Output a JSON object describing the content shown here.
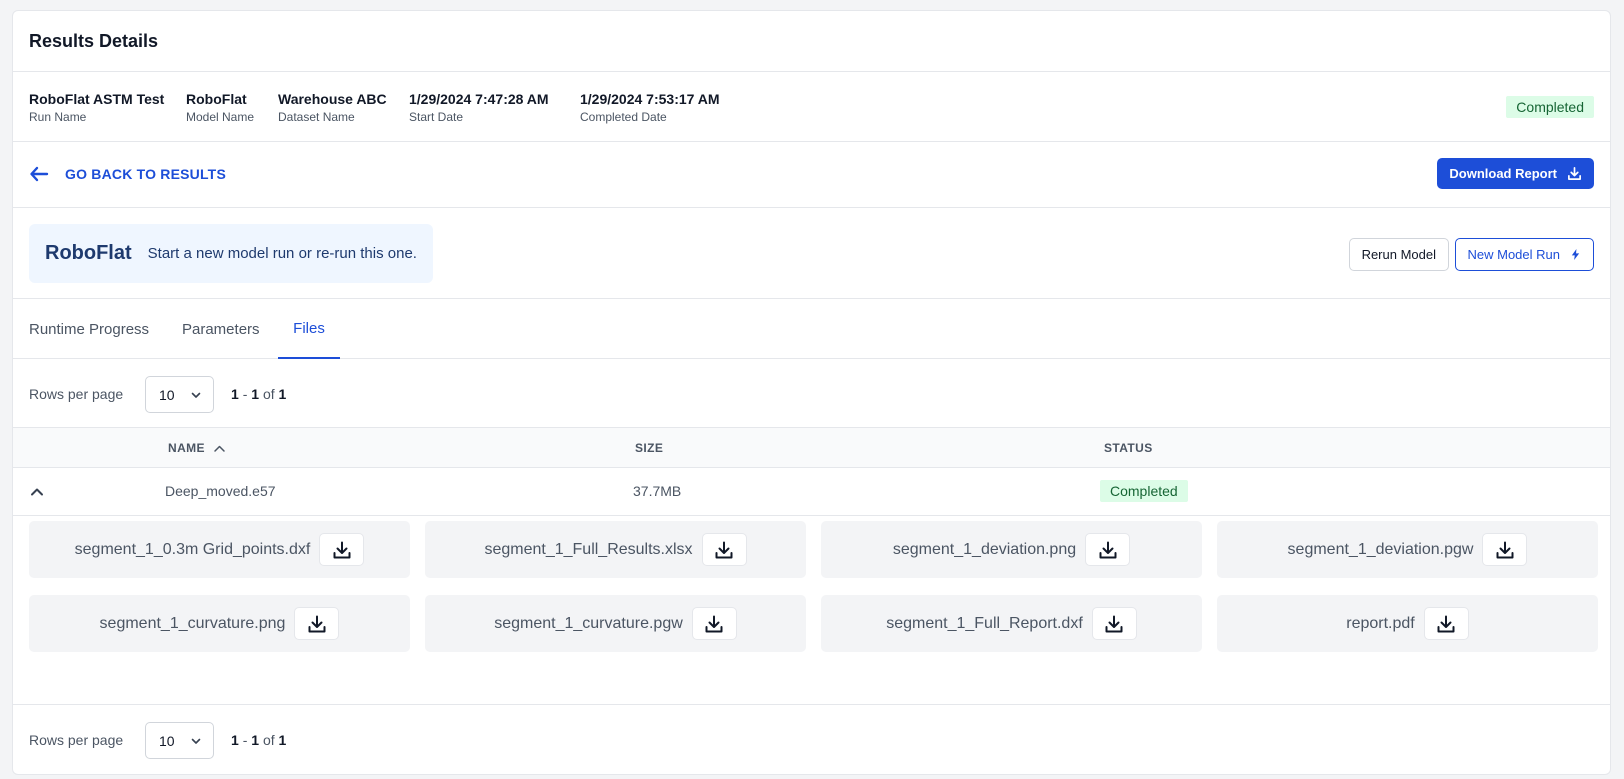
{
  "header": {
    "title": "Results Details"
  },
  "run": {
    "run_name": {
      "value": "RoboFlat ASTM Test",
      "label": "Run Name"
    },
    "model_name": {
      "value": "RoboFlat",
      "label": "Model Name"
    },
    "dataset_name": {
      "value": "Warehouse ABC",
      "label": "Dataset Name"
    },
    "start_date": {
      "value": "1/29/2024 7:47:28 AM",
      "label": "Start Date"
    },
    "completed_date": {
      "value": "1/29/2024 7:53:17 AM",
      "label": "Completed Date"
    },
    "status": "Completed"
  },
  "nav": {
    "back_label": "GO BACK TO RESULTS",
    "download_report_label": "Download Report"
  },
  "model_banner": {
    "model_name": "RoboFlat",
    "subtitle": "Start a new model run or re-run this one.",
    "rerun_label": "Rerun Model",
    "new_run_label": "New Model Run"
  },
  "tabs": [
    {
      "label": "Runtime Progress"
    },
    {
      "label": "Parameters"
    },
    {
      "label": "Files",
      "active": true
    }
  ],
  "pagination": {
    "rows_label": "Rows per page",
    "rows_value": "10",
    "range_start": "1",
    "range_sep": "-",
    "range_end": "1",
    "of_label": "of",
    "total": "1"
  },
  "table": {
    "columns": {
      "name": "NAME",
      "size": "SIZE",
      "status": "STATUS"
    },
    "rows": [
      {
        "name": "Deep_moved.e57",
        "size": "37.7MB",
        "status": "Completed"
      }
    ]
  },
  "files": [
    "segment_1_0.3m Grid_points.dxf",
    "segment_1_Full_Results.xlsx",
    "segment_1_deviation.png",
    "segment_1_deviation.pgw",
    "segment_1_curvature.png",
    "segment_1_curvature.pgw",
    "segment_1_Full_Report.dxf",
    "report.pdf"
  ],
  "colors": {
    "primary": "#1d4ed8",
    "success_bg": "#dcfce7",
    "success_text": "#166534",
    "callout_bg": "#eff6ff"
  },
  "icons": {
    "back": "arrow-left-icon",
    "download": "download-icon",
    "lightning": "lightning-icon",
    "sort": "chevron-up-icon",
    "select": "chevron-down-icon",
    "expand": "chevron-up-icon"
  }
}
